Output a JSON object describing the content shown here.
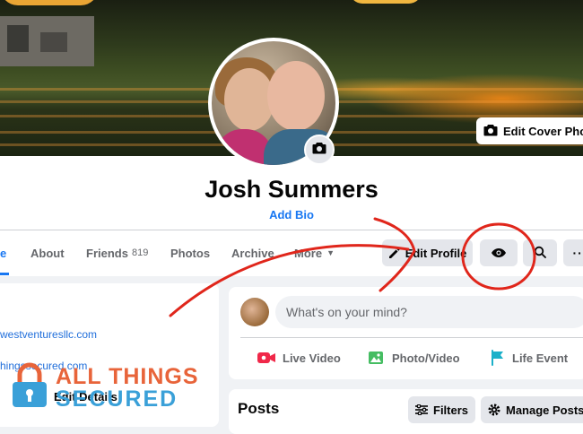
{
  "cover": {
    "edit_label": "Edit Cover Phot"
  },
  "profile": {
    "name": "Josh Summers",
    "bio_link": "Add Bio"
  },
  "tabs": [
    {
      "label": "e",
      "active": true
    },
    {
      "label": "About"
    },
    {
      "label": "Friends",
      "count": "819"
    },
    {
      "label": "Photos"
    },
    {
      "label": "Archive"
    },
    {
      "label": "More"
    }
  ],
  "buttons": {
    "edit_profile": "Edit Profile"
  },
  "intro": {
    "links": [
      "westventuresllc.com",
      "hingssecured.com"
    ],
    "edit_details": "Edit Details"
  },
  "composer": {
    "placeholder": "What's on your mind?",
    "actions": [
      "Live Video",
      "Photo/Video",
      "Life Event"
    ]
  },
  "posts": {
    "title": "Posts",
    "filters_label": "Filters",
    "manage_label": "Manage Posts"
  },
  "watermark": {
    "line1": "ALL THINGS",
    "line2": "SECURED"
  },
  "colors": {
    "accent": "#1877f2",
    "annotation": "#e0261b",
    "watermark_orange": "#e8643a",
    "watermark_blue": "#3aa0d8"
  }
}
